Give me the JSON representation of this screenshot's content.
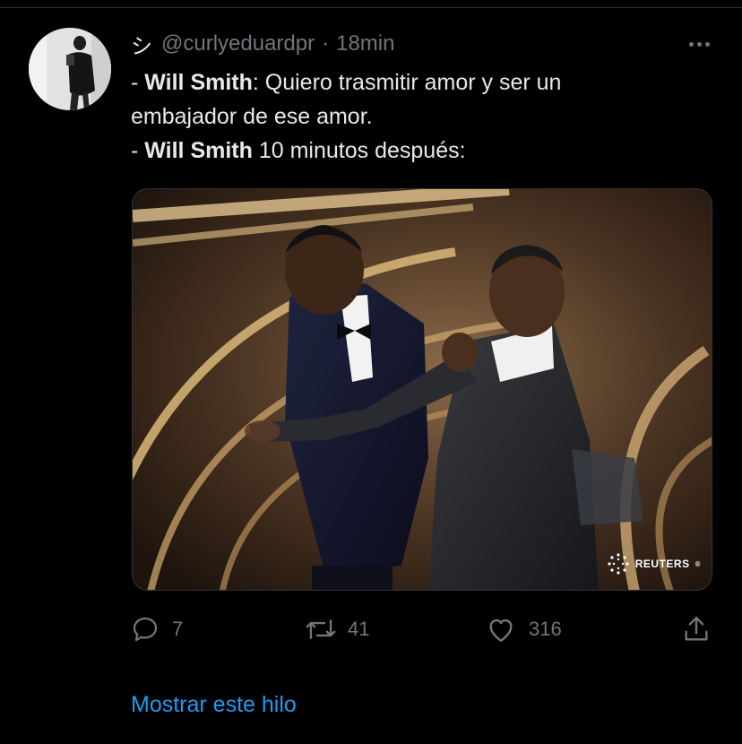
{
  "tweet": {
    "display_name": "シ",
    "handle": "@curlyeduardpr",
    "separator": "·",
    "time": "18min",
    "text": {
      "line1_prefix": "- ",
      "line1_bold": "Will Smith",
      "line1_rest": ": Quiero trasmitir amor y ser un",
      "line2": "embajador de ese amor.",
      "line3_prefix": "- ",
      "line3_bold": "Will Smith",
      "line3_rest": " 10 minutos después:"
    },
    "media": {
      "watermark": "REUTERS",
      "watermark_mark": "®"
    },
    "stats": {
      "replies": "7",
      "retweets": "41",
      "likes": "316"
    },
    "show_thread": "Mostrar este hilo"
  },
  "icons": {
    "more": "more-horizontal-icon",
    "reply": "reply-bubble-icon",
    "retweet": "retweet-icon",
    "like": "heart-icon",
    "share": "share-upload-icon"
  },
  "colors": {
    "background": "#000000",
    "text_primary": "#e7e9ea",
    "text_secondary": "#71767b",
    "link": "#1d9bf0",
    "border": "#2f3336"
  }
}
